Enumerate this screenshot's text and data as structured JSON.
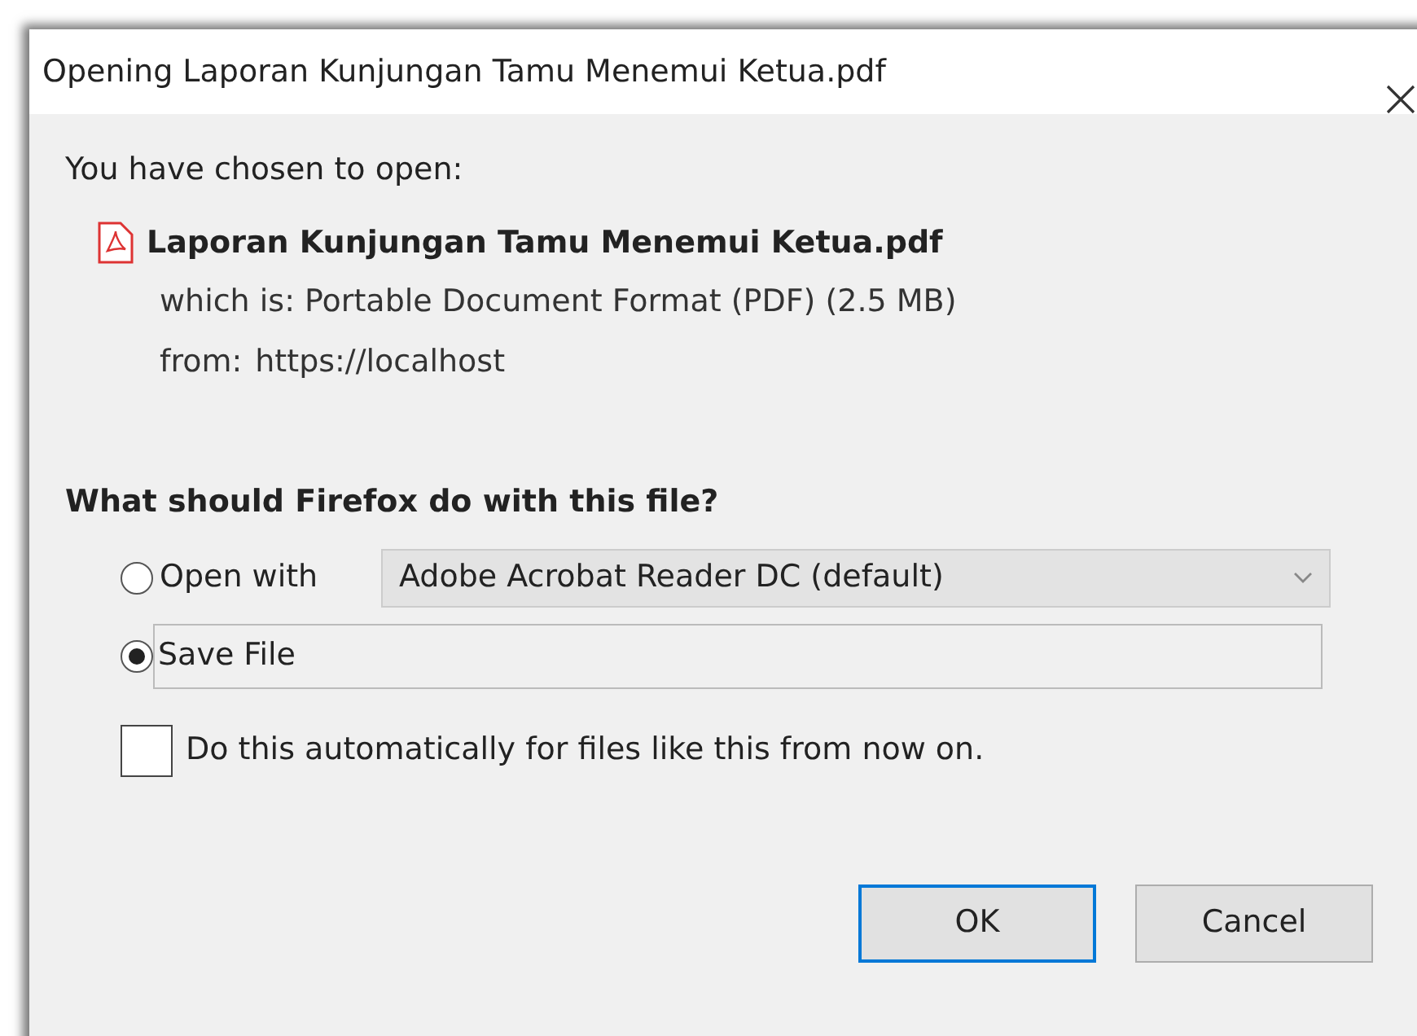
{
  "window": {
    "title": "Opening Laporan Kunjungan Tamu Menemui Ketua.pdf"
  },
  "intro": "You have chosen to open:",
  "file": {
    "name": "Laporan Kunjungan Tamu Menemui Ketua.pdf",
    "type_line": "which is: Portable Document Format (PDF) (2.5 MB)",
    "from_label": "from:",
    "from_value": "https://localhost"
  },
  "question": "What should Firefox do with this file?",
  "options": [
    {
      "kind": "app",
      "label": "Open with",
      "selected": false,
      "app": "Adobe Acrobat Reader DC (default)"
    },
    {
      "kind": "save",
      "label": "Save File",
      "selected": true
    }
  ],
  "auto": {
    "label": "Do this automatically for files like this from now on.",
    "checked": false
  },
  "buttons": [
    {
      "label": "OK",
      "focused": true
    },
    {
      "label": "Cancel",
      "focused": false
    }
  ]
}
